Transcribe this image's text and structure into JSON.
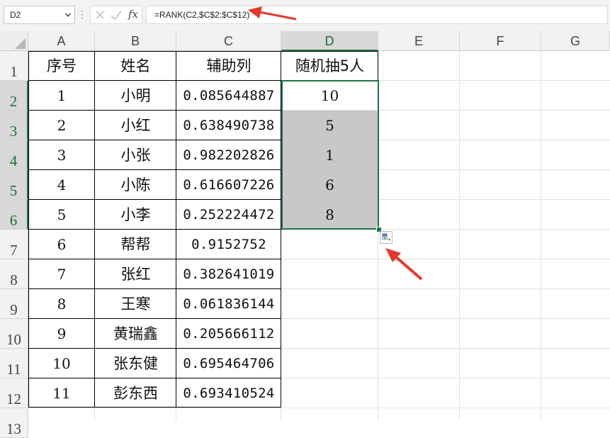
{
  "formula_bar": {
    "name_box": "D2",
    "fx_label": "fx",
    "formula": "=RANK(C2,$C$2:$C$12)"
  },
  "columns": [
    "A",
    "B",
    "C",
    "D",
    "E",
    "F",
    "G"
  ],
  "selected_column": "D",
  "rows": [
    "1",
    "2",
    "3",
    "4",
    "5",
    "6",
    "7",
    "8",
    "9",
    "10",
    "11",
    "12",
    "13"
  ],
  "selected_rows": [
    "2",
    "3",
    "4",
    "5",
    "6"
  ],
  "headers": {
    "a": "序号",
    "b": "姓名",
    "c": "辅助列",
    "d": "随机抽5人"
  },
  "table": [
    {
      "a": "1",
      "b": "小明",
      "c": "0.085644887",
      "d": "10"
    },
    {
      "a": "2",
      "b": "小红",
      "c": "0.638490738",
      "d": "5"
    },
    {
      "a": "3",
      "b": "小张",
      "c": "0.982202826",
      "d": "1"
    },
    {
      "a": "4",
      "b": "小陈",
      "c": "0.616607226",
      "d": "6"
    },
    {
      "a": "5",
      "b": "小李",
      "c": "0.252224472",
      "d": "8"
    },
    {
      "a": "6",
      "b": "帮帮",
      "c": "0.9152752",
      "d": ""
    },
    {
      "a": "7",
      "b": "张红",
      "c": "0.382641019",
      "d": ""
    },
    {
      "a": "8",
      "b": "王寒",
      "c": "0.061836144",
      "d": ""
    },
    {
      "a": "9",
      "b": "黄瑞鑫",
      "c": "0.205666112",
      "d": ""
    },
    {
      "a": "10",
      "b": "张东健",
      "c": "0.695464706",
      "d": ""
    },
    {
      "a": "11",
      "b": "彭东西",
      "c": "0.693410524",
      "d": ""
    }
  ],
  "colors": {
    "selection_border": "#217346",
    "selected_fill": "#c8c8c8",
    "annotation_arrow": "#e8382c"
  }
}
